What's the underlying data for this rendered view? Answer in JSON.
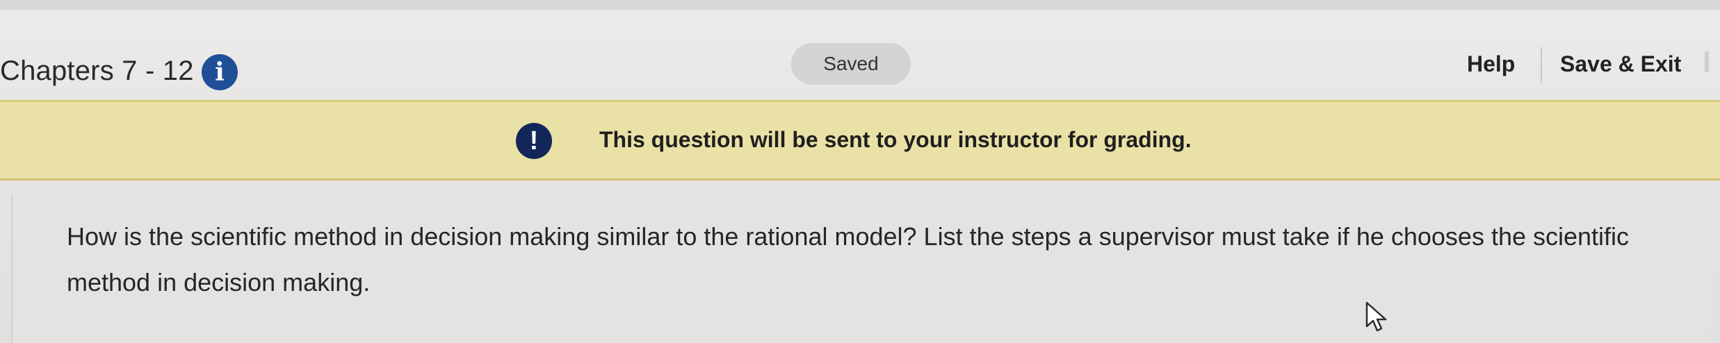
{
  "header": {
    "title": "Chapters 7 - 12",
    "info_icon": "info-icon",
    "status": "Saved",
    "help_label": "Help",
    "save_exit_label": "Save & Exit"
  },
  "banner": {
    "icon": "alert-icon",
    "message": "This question will be sent to your instructor for grading."
  },
  "question": {
    "text": "How is the scientific method in decision making similar to the rational model? List the steps a supervisor must take if he chooses the scientific method in decision making."
  },
  "colors": {
    "info_icon": "#1f4f97",
    "banner_background": "#e9e1a6",
    "alert_icon": "#12265a"
  }
}
